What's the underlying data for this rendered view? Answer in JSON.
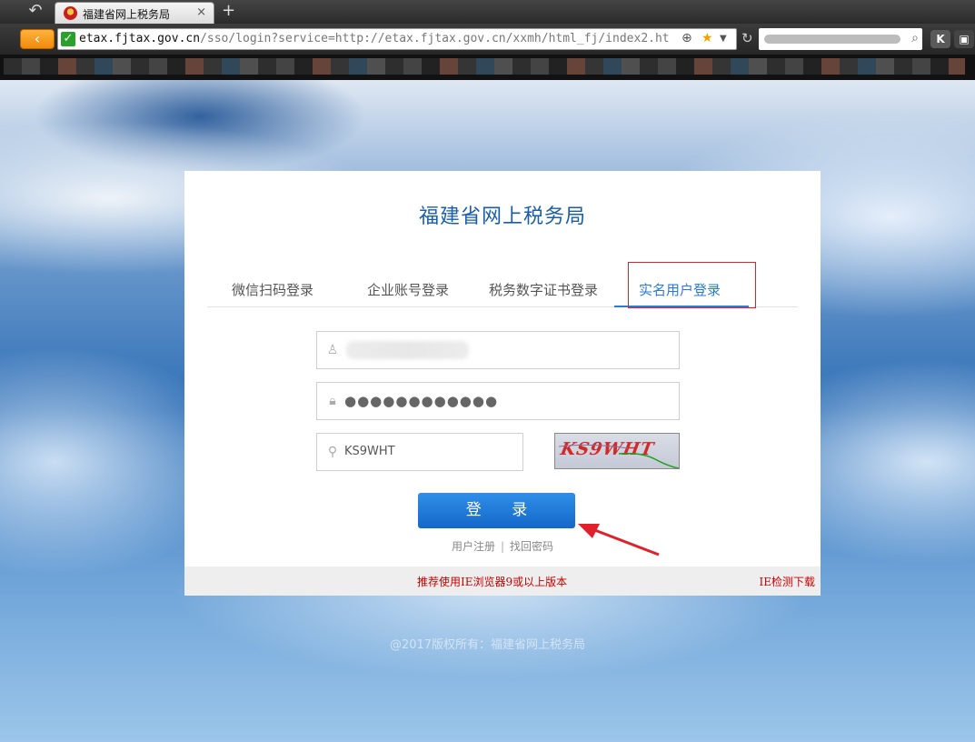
{
  "browser": {
    "tab_title": "福建省网上税务局",
    "tab_close": "×",
    "new_tab": "+",
    "back_glyph": "‹",
    "url_host": "etax.fjtax.gov.cn",
    "url_path": "/sso/login?service=http://etax.fjtax.gov.cn/xxmh/html_fj/index2.ht",
    "ext_label": "K"
  },
  "card": {
    "title": "福建省网上税务局",
    "tabs": [
      {
        "label": "微信扫码登录"
      },
      {
        "label": "企业账号登录"
      },
      {
        "label": "税务数字证书登录"
      },
      {
        "label": "实名用户登录"
      }
    ],
    "password_mask": "●●●●●●●●●●●●",
    "captcha_input": "KS9WHT",
    "captcha_image_text": "KS9WHT",
    "login_button": "登 录",
    "register_link": "用户注册",
    "link_separator": "|",
    "forgot_link": "找回密码",
    "browser_tip": "推荐使用IE浏览器9或以上版本",
    "ie_link": "IE检测下载"
  },
  "page": {
    "copyright": "@2017版权所有：福建省网上税务局"
  },
  "colors": {
    "brand_blue": "#1a5ea8",
    "active_tab": "#2a7bd6",
    "button": "#1468c8",
    "warning_red": "#cc0000",
    "annotation_red": "#e0202a"
  }
}
